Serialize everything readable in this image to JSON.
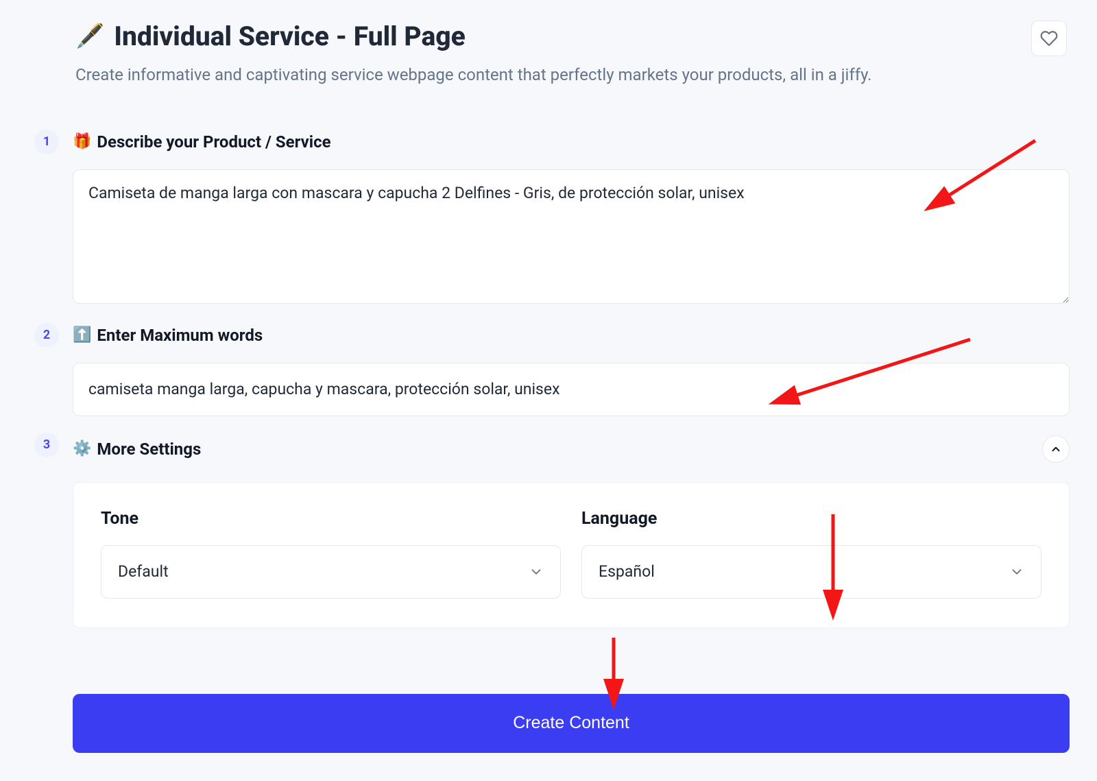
{
  "header": {
    "icon": "🖋️",
    "title": "Individual Service - Full Page",
    "description": "Create informative and captivating service webpage content that perfectly markets your products, all in a jiffy."
  },
  "steps": {
    "s1": {
      "num": "1",
      "icon": "🎁",
      "label": "Describe your Product / Service",
      "value": "Camiseta de manga larga con mascara y capucha 2 Delfines - Gris, de protección solar, unisex"
    },
    "s2": {
      "num": "2",
      "icon": "⬆️",
      "label": "Enter Maximum words",
      "value": "camiseta manga larga, capucha y mascara, protección solar, unisex"
    },
    "s3": {
      "num": "3",
      "icon": "⚙️",
      "label": "More Settings"
    }
  },
  "settings": {
    "tone_label": "Tone",
    "tone_value": "Default",
    "language_label": "Language",
    "language_value": "Español"
  },
  "cta_label": "Create Content"
}
